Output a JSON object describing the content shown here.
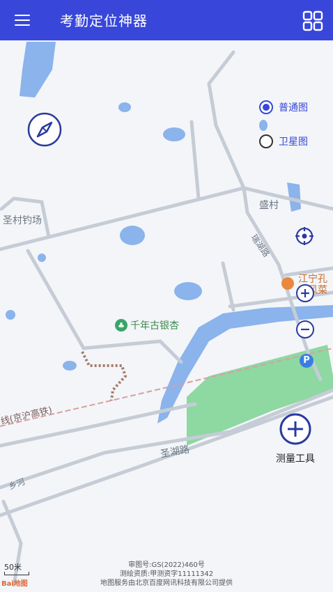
{
  "app": {
    "title": "考勤定位神器"
  },
  "layers": [
    {
      "label": "普通图",
      "selected": true
    },
    {
      "label": "卫星图",
      "selected": false
    }
  ],
  "map_labels": {
    "fishing": "圣村钓场",
    "shengcun": "盛村",
    "road1": "瑞湖路",
    "jiangning": "江宁孔",
    "jiangning2": "东风菜",
    "ginkgo": "千年古银杏",
    "railway": "线(京沪高铁)",
    "shenghu": "圣湖路",
    "river": "乡河"
  },
  "tools": {
    "measure_label": "测量工具"
  },
  "scale": {
    "label": "50米"
  },
  "baidu_logo": "Bai地图",
  "copyright": {
    "line1": "审图号:GS(2022)460号",
    "line2": "测绘资质:甲测资字11111342",
    "line3": "地图服务由北京百度网讯科技有限公司提供"
  },
  "icons": {
    "menu": "menu-icon",
    "grid": "grid-icon",
    "compass": "compass-icon",
    "locate": "locate-icon",
    "zoom_in": "zoom-in-icon",
    "zoom_out": "zoom-out-icon",
    "parking": "parking-icon",
    "measure": "plus-icon"
  },
  "colors": {
    "primary": "#3847d9",
    "water": "#8bb3ec",
    "green": "#8ed8a2",
    "road": "#c5ccd6"
  }
}
